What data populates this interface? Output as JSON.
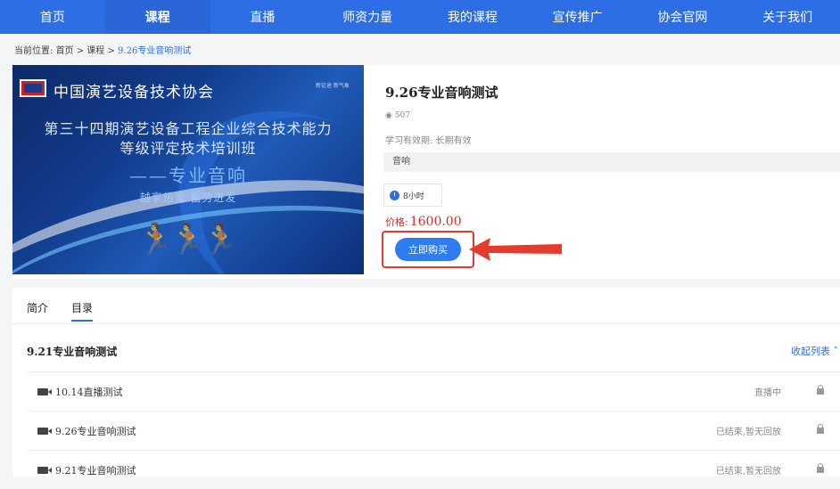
{
  "nav": {
    "items": [
      "首页",
      "课程",
      "直播",
      "师资力量",
      "我的课程",
      "宣传推广",
      "协会官网",
      "关于我们"
    ],
    "active_index": 1
  },
  "breadcrumb": {
    "prefix": "当前位置:",
    "path": "首页 > 课程 >",
    "current": "9.26专业音响测试"
  },
  "banner": {
    "org_name": "中国演艺设备技术协会",
    "corner_text": "新征途 新气象",
    "line1": "第三十四期演艺设备工程企业综合技术能力",
    "line2": "等级评定技术培训班",
    "line3": "——专业音响",
    "line4": "越享热爱 蓄势进发"
  },
  "course": {
    "title": "9.26专业音响测试",
    "views": "507",
    "validity": "学习有效期: 长期有效",
    "tag": "音响",
    "duration": "8小时",
    "price_label": "价格:",
    "price": "1600.00",
    "buy_label": "立即购买"
  },
  "tabs": [
    "简介",
    "目录"
  ],
  "active_tab": 1,
  "catalog": {
    "section_title": "9.21专业音响测试",
    "collapse_label": "收起列表",
    "rows": [
      {
        "name": "10.14直播测试",
        "status": "直播中"
      },
      {
        "name": "9.26专业音响测试",
        "status": "已结束,暂无回放"
      },
      {
        "name": "9.21专业音响测试",
        "status": "已结束,暂无回放"
      }
    ]
  },
  "colors": {
    "nav_bg": "#2d6ee6",
    "price": "#c9302c",
    "buy_button": "#2d7df0",
    "highlight": "#e43b2c"
  }
}
